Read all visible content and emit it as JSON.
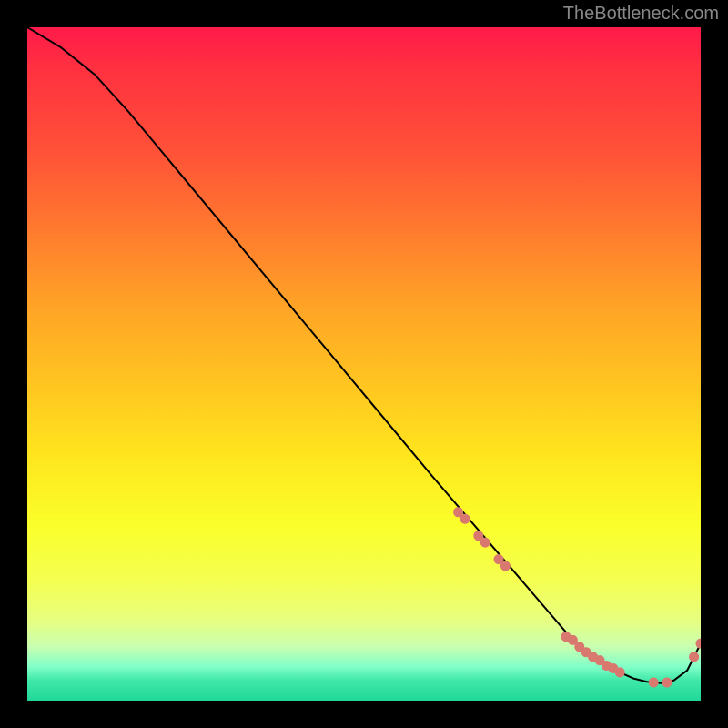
{
  "watermark": "TheBottleneck.com",
  "chart_data": {
    "type": "line",
    "title": "",
    "xlabel": "",
    "ylabel": "",
    "xlim": [
      0,
      100
    ],
    "ylim": [
      0,
      100
    ],
    "series": [
      {
        "name": "curve",
        "x": [
          0,
          5,
          10,
          15,
          20,
          25,
          30,
          35,
          40,
          45,
          50,
          55,
          60,
          63,
          66,
          69,
          72,
          75,
          78,
          81,
          82,
          84,
          86,
          88,
          90,
          92,
          94,
          96,
          98,
          100
        ],
        "values": [
          100,
          97,
          93,
          87.5,
          81.5,
          75.5,
          69.5,
          63.5,
          57.5,
          51.5,
          45.5,
          39.5,
          33.5,
          30,
          26.5,
          23,
          19.5,
          16,
          12.5,
          9,
          8,
          6.5,
          5.2,
          4.2,
          3.3,
          2.8,
          2.6,
          3,
          4.5,
          8.5
        ]
      }
    ],
    "markers": [
      {
        "x": 64,
        "y": 28
      },
      {
        "x": 65,
        "y": 27
      },
      {
        "x": 67,
        "y": 24.5
      },
      {
        "x": 68,
        "y": 23.5
      },
      {
        "x": 70,
        "y": 21
      },
      {
        "x": 71,
        "y": 20
      },
      {
        "x": 80,
        "y": 9.5
      },
      {
        "x": 81,
        "y": 9
      },
      {
        "x": 82,
        "y": 8
      },
      {
        "x": 83,
        "y": 7.2
      },
      {
        "x": 84,
        "y": 6.5
      },
      {
        "x": 85,
        "y": 6
      },
      {
        "x": 86,
        "y": 5.2
      },
      {
        "x": 87,
        "y": 4.8
      },
      {
        "x": 88,
        "y": 4.2
      },
      {
        "x": 93,
        "y": 2.7
      },
      {
        "x": 95,
        "y": 2.7
      },
      {
        "x": 99,
        "y": 6.5
      },
      {
        "x": 100,
        "y": 8.5
      }
    ],
    "marker_color": "#d9786f",
    "line_color": "#000000"
  }
}
